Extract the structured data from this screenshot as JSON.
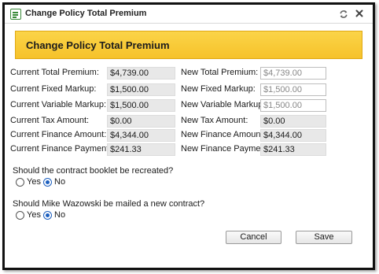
{
  "window": {
    "title": "Change Policy Total Premium"
  },
  "banner": {
    "title": "Change Policy Total Premium"
  },
  "current": {
    "total_premium_label": "Current Total Premium:",
    "total_premium_value": "$4,739.00",
    "fixed_markup_label": "Current Fixed Markup:",
    "fixed_markup_value": "$1,500.00",
    "variable_markup_label": "Current Variable Markup:",
    "variable_markup_value": "$1,500.00",
    "tax_amount_label": "Current Tax Amount:",
    "tax_amount_value": "$0.00",
    "finance_amount_label": "Current Finance Amount:",
    "finance_amount_value": "$4,344.00",
    "finance_payment_label": "Current Finance Payment:",
    "finance_payment_value": "$241.33"
  },
  "new": {
    "total_premium_label": "New Total Premium:",
    "total_premium_value": "$4,739.00",
    "fixed_markup_label": "New Fixed Markup:",
    "fixed_markup_value": "$1,500.00",
    "variable_markup_label": "New Variable Markup:",
    "variable_markup_value": "$1,500.00",
    "tax_amount_label": "New Tax Amount:",
    "tax_amount_value": "$0.00",
    "finance_amount_label": "New Finance Amount:",
    "finance_amount_value": "$4,344.00",
    "finance_payment_label": "New Finance Payment:",
    "finance_payment_value": "$241.33"
  },
  "questions": {
    "booklet": {
      "text": "Should the contract booklet be recreated?",
      "yes_label": "Yes",
      "no_label": "No",
      "selected": "No"
    },
    "mail": {
      "text": "Should Mike Wazowski be mailed a new contract?",
      "yes_label": "Yes",
      "no_label": "No",
      "selected": "No"
    }
  },
  "buttons": {
    "cancel_label": "Cancel",
    "save_label": "Save"
  },
  "icons": {
    "title": "form-icon",
    "refresh": "refresh-icon",
    "close": "close-icon"
  },
  "colors": {
    "banner": "#f6c22a",
    "radio_selected": "#1c5fbf",
    "title_icon": "#3a8a3a"
  }
}
